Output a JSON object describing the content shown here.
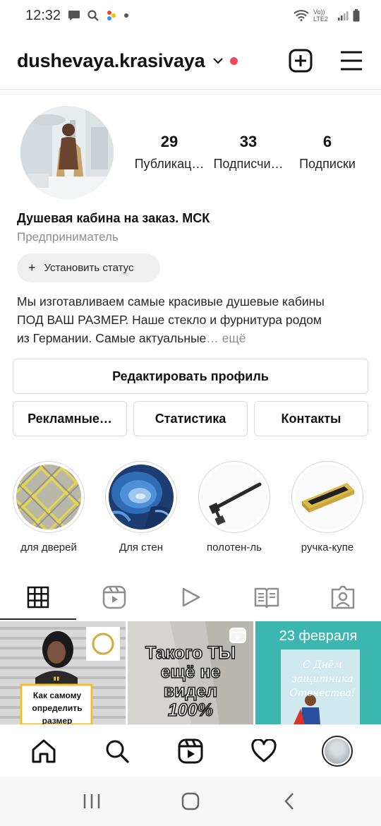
{
  "status_bar": {
    "time": "12:32",
    "network": "Vo)) LTE2"
  },
  "header": {
    "username": "dushevaya.krasivaya"
  },
  "profile": {
    "stats": [
      {
        "number": "29",
        "label": "Публикац…"
      },
      {
        "number": "33",
        "label": "Подписчи…"
      },
      {
        "number": "6",
        "label": "Подписки"
      }
    ],
    "name": "Душевая кабина на заказ. МСК",
    "category": "Предприниматель",
    "status_button": "Установить статус",
    "bio_line1": "Мы изготавливаем самые красивые душевые кабины",
    "bio_line2": "ПОД ВАШ РАЗМЕР. Наше стекло  и фурнитура родом",
    "bio_line3": "из Германии. Самые актуальные",
    "bio_more": "… ещё"
  },
  "buttons": {
    "edit_profile": "Редактировать профиль",
    "ads": "Рекламные…",
    "statistics": "Статистика",
    "contacts": "Контакты"
  },
  "highlights": [
    {
      "label": "для дверей"
    },
    {
      "label": "Для стен"
    },
    {
      "label": "полотен-ль"
    },
    {
      "label": "ручка-купе"
    }
  ],
  "posts": [
    {
      "text": "Как самому определить размер"
    },
    {
      "text_line1": "Такого ТЫ",
      "text_line2": "ещё не",
      "text_line3": "видел",
      "text_line4": "100%"
    },
    {
      "text": "23 февраля",
      "sub_line1": "С Днём",
      "sub_line2": "защитника",
      "sub_line3": "Отечества!"
    }
  ],
  "colors": {
    "accent_red": "#ed4956",
    "text": "#262626",
    "secondary": "#8e8e8e",
    "border": "#dbdbdb"
  }
}
